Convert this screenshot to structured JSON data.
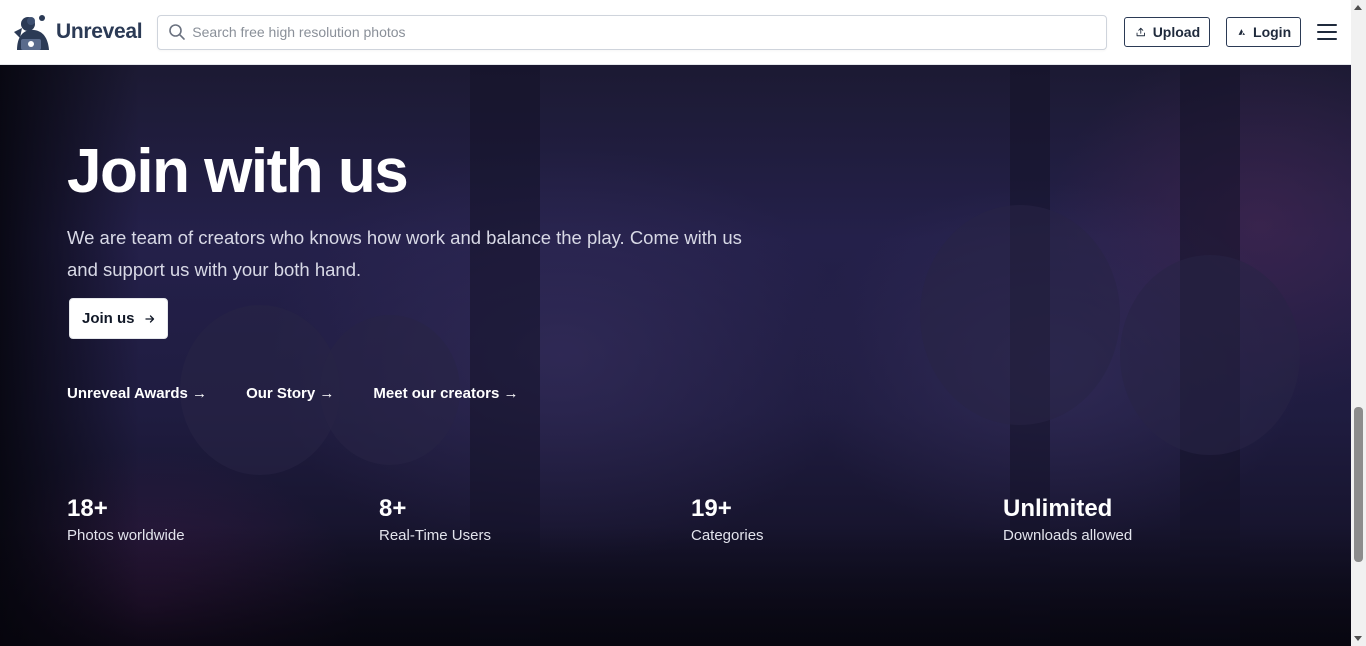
{
  "brand": {
    "name": "Unreveal"
  },
  "search": {
    "placeholder": "Search free high resolution photos"
  },
  "nav": {
    "upload_label": "Upload",
    "login_label": "Login"
  },
  "hero": {
    "title": "Join with us",
    "subtitle": "We are team of creators who knows how work and balance the play. Come with us and support us with your both hand.",
    "cta_label": "Join us",
    "links": [
      {
        "label": "Unreveal Awards →"
      },
      {
        "label": "Our Story →"
      },
      {
        "label": "Meet our creators →"
      }
    ]
  },
  "stats": [
    {
      "value": "18+",
      "label": "Photos worldwide"
    },
    {
      "value": "8+",
      "label": "Real-Time Users"
    },
    {
      "value": "19+",
      "label": "Categories"
    },
    {
      "value": "Unlimited",
      "label": "Downloads allowed"
    }
  ],
  "icons": {
    "search": "search-icon",
    "upload": "upload-icon",
    "login": "login-logo-icon",
    "menu": "hamburger-menu-icon",
    "cta_arrow": "arrow-right-icon"
  }
}
